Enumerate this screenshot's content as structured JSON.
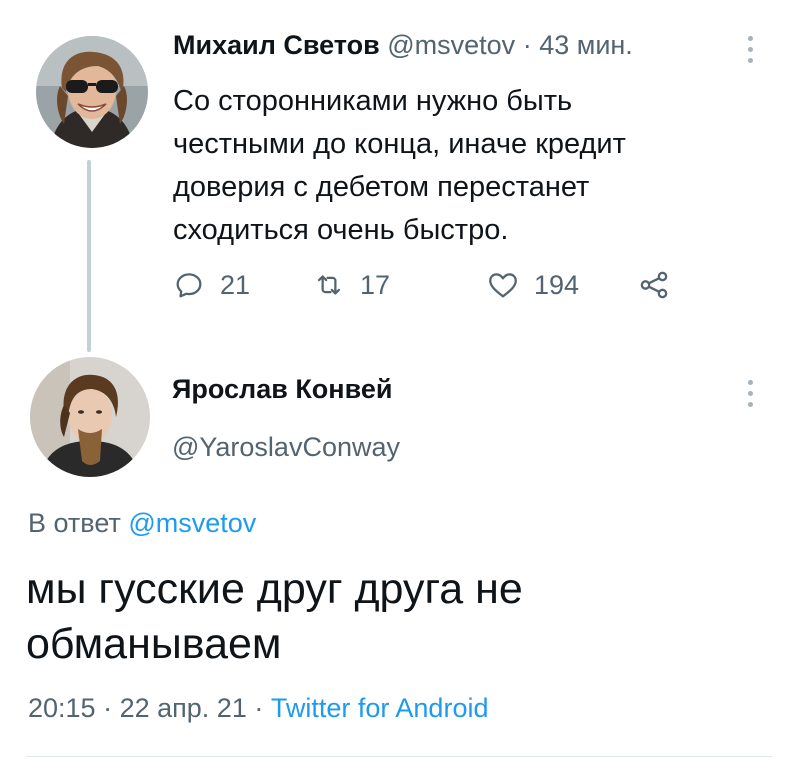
{
  "tweet1": {
    "author_name": "Михаил Светов",
    "handle": "@msvetov",
    "separator": "·",
    "time": "43 мин.",
    "text_lines": [
      "Со сторонниками нужно быть",
      "честными до конца, иначе кредит",
      "доверия с дебетом перестанет",
      "сходиться очень быстро."
    ],
    "replies": "21",
    "retweets": "17",
    "likes": "194"
  },
  "tweet2": {
    "author_name": "Ярослав Конвей",
    "handle": "@YaroslavConway",
    "reply_prefix": "В ответ",
    "reply_to": "@msvetov",
    "text_lines": [
      "мы гусские друг друга не",
      "обманываем"
    ],
    "time": "20:15",
    "separator": "·",
    "date": "22 апр. 21",
    "source": "Twitter for Android"
  },
  "icons": {
    "reply": "reply-icon",
    "retweet": "retweet-icon",
    "like": "heart-icon",
    "share": "share-icon",
    "more": "more-vertical-icon"
  },
  "colors": {
    "link": "#1d9bf0",
    "muted": "#536471",
    "text": "#0f1419",
    "thread_line": "#c4cfd6"
  }
}
